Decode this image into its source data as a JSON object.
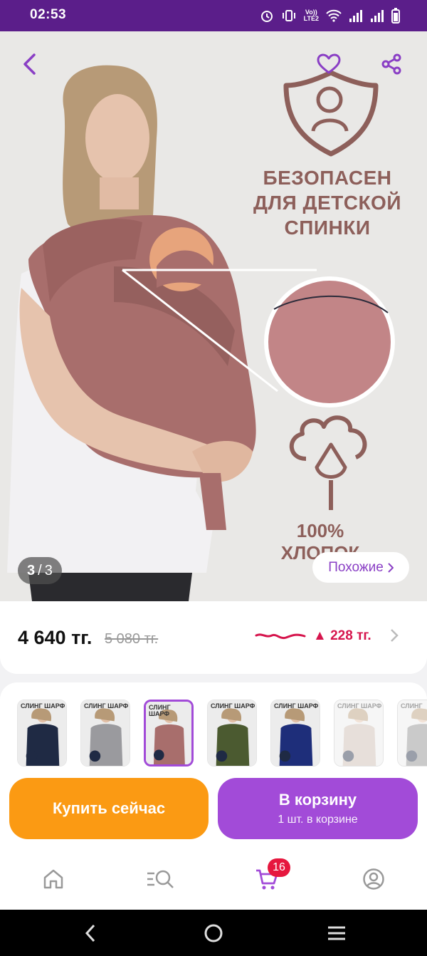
{
  "status_bar": {
    "time": "02:53",
    "volte_line1": "Vo))",
    "volte_line2": "LTE2"
  },
  "gallery": {
    "promo_title": "БЕЗОПАСЕН ДЛЯ ДЕТСКОЙ СПИНКИ",
    "promo_cotton_line1": "100%",
    "promo_cotton_line2": "ХЛОПОК",
    "counter_current": "3",
    "counter_sep": "/",
    "counter_total": "3",
    "similar_label": "Похожие"
  },
  "price": {
    "current": "4 640 тг.",
    "old": "5 080 тг.",
    "drop": "▲ 228 тг."
  },
  "variants": [
    {
      "label": "СЛИНГ ШАРФ",
      "color": "#1f2a44",
      "selected": false,
      "faded": false
    },
    {
      "label": "СЛИНГ ШАРФ",
      "color": "#9a9a9e",
      "selected": false,
      "faded": false
    },
    {
      "label": "СЛИНГ ШАРФ",
      "color": "#a86e6c",
      "selected": true,
      "faded": false
    },
    {
      "label": "СЛИНГ ШАРФ",
      "color": "#4b5a30",
      "selected": false,
      "faded": false
    },
    {
      "label": "СЛИНГ ШАРФ",
      "color": "#1e2e7a",
      "selected": false,
      "faded": false
    },
    {
      "label": "СЛИНГ ШАРФ",
      "color": "#c9b8ae",
      "selected": false,
      "faded": true
    },
    {
      "label": "СЛИНГ",
      "color": "#8a8a8a",
      "selected": false,
      "faded": true
    }
  ],
  "actions": {
    "buy_now": "Купить сейчас",
    "add_to_cart": "В корзину",
    "in_cart": "1 шт. в корзине"
  },
  "bottom_nav": {
    "cart_badge": "16"
  },
  "colors": {
    "brand_purple": "#a24bd8",
    "status_purple": "#5b1e8a",
    "buy_orange": "#fb9a13",
    "badge_red": "#e6173e",
    "price_drop_red": "#d6154d"
  },
  "icons": [
    "back-arrow-icon",
    "heart-icon",
    "share-icon",
    "shield-baby-icon",
    "cotton-icon",
    "chevron-right-icon",
    "home-icon",
    "catalog-search-icon",
    "cart-icon",
    "profile-icon"
  ]
}
